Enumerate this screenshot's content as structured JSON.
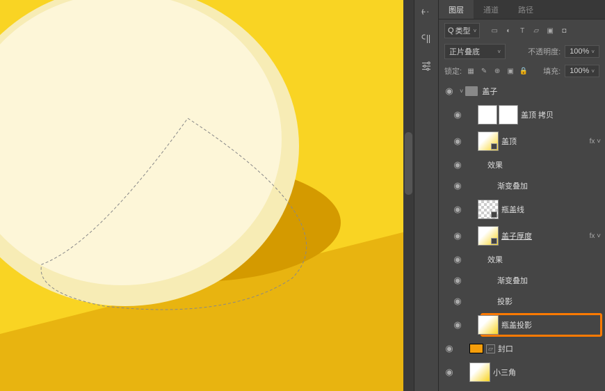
{
  "tabs": {
    "layers": "图层",
    "channels": "通道",
    "paths": "路径"
  },
  "filter": {
    "type": "类型"
  },
  "blend": {
    "mode": "正片叠底",
    "opacity_label": "不透明度:",
    "opacity_value": "100%"
  },
  "lock": {
    "label": "锁定:",
    "fill_label": "填充:",
    "fill_value": "100%"
  },
  "layers": [
    {
      "name": "盖子",
      "kind": "group"
    },
    {
      "name": "盖顶 拷贝",
      "kind": "smart-dual"
    },
    {
      "name": "盖顶",
      "kind": "smart",
      "fx": true
    },
    {
      "name": "效果",
      "kind": "fx-head"
    },
    {
      "name": "渐变叠加",
      "kind": "fx-item"
    },
    {
      "name": "瓶盖线",
      "kind": "smart"
    },
    {
      "name": "盖子厚度",
      "kind": "smart",
      "fx": true,
      "underline": true
    },
    {
      "name": "效果",
      "kind": "fx-head"
    },
    {
      "name": "渐变叠加",
      "kind": "fx-item"
    },
    {
      "name": "投影",
      "kind": "fx-item"
    },
    {
      "name": "瓶盖投影",
      "kind": "layer",
      "highlight": true
    },
    {
      "name": "封口",
      "kind": "shape"
    },
    {
      "name": "小三角",
      "kind": "layer"
    }
  ],
  "glyph": {
    "eye": "◉",
    "fx": "fx ˅",
    "search": "Q",
    "page": "▭",
    "circle": "◐",
    "T": "T",
    "shape": "▱",
    "smart": "▣",
    "art": "◘"
  }
}
